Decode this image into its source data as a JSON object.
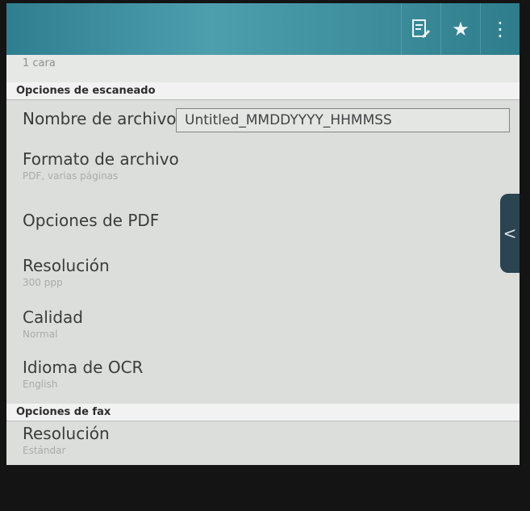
{
  "toolbar": {
    "actions": [
      {
        "icon": "edit-document-icon",
        "glyph": "🖹"
      },
      {
        "icon": "star-icon",
        "glyph": "★"
      },
      {
        "icon": "overflow-menu-icon",
        "glyph": "⋮"
      }
    ]
  },
  "list": {
    "previous_item_value": "1 cara",
    "scan_section": {
      "header": "Opciones de escaneado",
      "file_name_label": "Nombre de archivo",
      "file_name_value": "Untitled_MMDDYYYY_HHMMSS",
      "file_format_label": "Formato de archivo",
      "file_format_value": "PDF, varias páginas",
      "pdf_options_label": "Opciones de PDF",
      "resolution_label": "Resolución",
      "resolution_value": "300 ppp",
      "quality_label": "Calidad",
      "quality_value": "Normal",
      "ocr_language_label": "Idioma de OCR",
      "ocr_language_value": "English"
    },
    "fax_section": {
      "header": "Opciones de fax",
      "resolution_label": "Resolución",
      "resolution_value": "Estándar"
    }
  },
  "side_panel": {
    "toggle_glyph": "<"
  }
}
